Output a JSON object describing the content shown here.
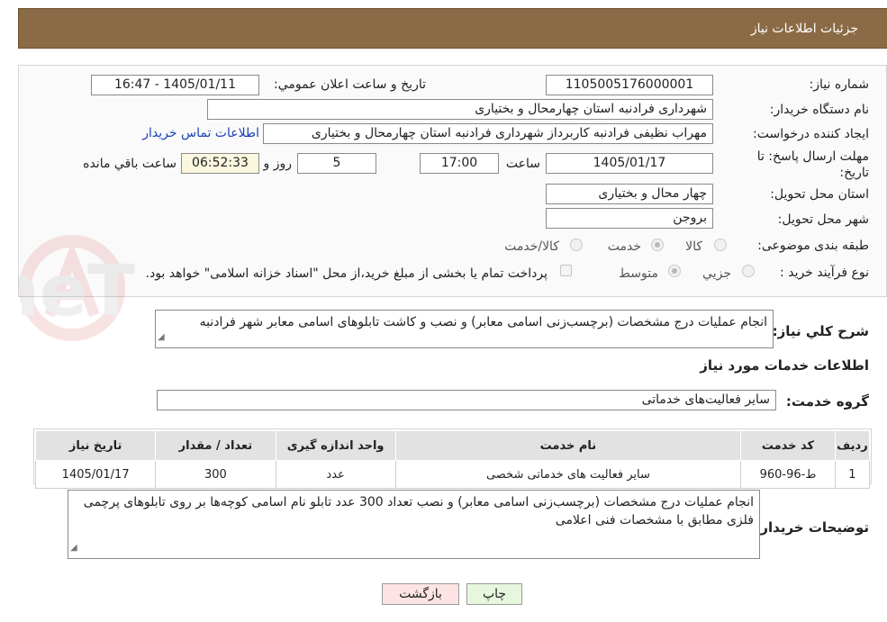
{
  "header": {
    "title": "جزئیات اطلاعات نیاز"
  },
  "form": {
    "need_number_label": "شماره نیاز:",
    "need_number": "1105005176000001",
    "announce_label": "تاریخ و ساعت اعلان عمومي:",
    "announce_value": "1405/01/11 - 16:47",
    "buyer_org_label": "نام دستگاه خريدار:",
    "buyer_org": "شهرداری فرادنبه استان چهارمحال و بختیاری",
    "creator_label": "ايجاد کننده درخواست:",
    "creator": "مهراب نظیفی فرادنبه کاربرداز شهرداری فرادنبه استان چهارمحال و بختیاری",
    "contact_link": "اطلاعات تماس خريدار",
    "deadline_label": "مهلت ارسال پاسخ: تا تاریخ:",
    "deadline_date": "1405/01/17",
    "time_label": "ساعت",
    "deadline_time": "17:00",
    "days_value": "5",
    "days_label": "روز و",
    "remaining_time": "06:52:33",
    "remaining_label": "ساعت باقي مانده",
    "province_label": "استان محل تحویل:",
    "province": "چهار محال و بختیاری",
    "city_label": "شهر محل تحویل:",
    "city": "بروجن",
    "category_label": "طبقه بندی موضوعی:",
    "category_options": [
      "کالا",
      "خدمت",
      "کالا/خدمت"
    ],
    "category_selected": "خدمت",
    "process_label": "نوع فرآیند خرید :",
    "process_options": [
      "جزیي",
      "متوسط"
    ],
    "payment_note": "پرداخت تمام یا بخشی از مبلغ خرید،از محل \"اسناد خزانه اسلامی\" خواهد بود."
  },
  "summary": {
    "label": "شرح کلي نياز:",
    "text": "انجام عملیات درج مشخصات (برچسب‌زنی اسامی معابر) و نصب و کاشت تابلوهای اسامی معابر شهر فرادنبه"
  },
  "services": {
    "section_title": "اطلاعات خدمات مورد نياز",
    "group_label": "گروه خدمت:",
    "group_value": "سایر فعالیت‌های خدماتی",
    "columns": [
      "ردیف",
      "کد خدمت",
      "نام خدمت",
      "واحد اندازه گیری",
      "تعداد / مقدار",
      "تاریخ نیاز"
    ],
    "rows": [
      {
        "row": "1",
        "code": "ط-96-960",
        "name": "سایر فعالیت های خدماتی شخصی",
        "unit": "عدد",
        "qty": "300",
        "date": "1405/01/17"
      }
    ]
  },
  "buyer_notes": {
    "label": "توضیحات خریدار:",
    "text": "انجام عملیات درج مشخصات (برچسب‌زنی اسامی معابر) و نصب تعداد 300 عدد تابلو نام اسامی کوچه‌ها بر روی تابلوهای پرچمی فلزی مطابق با مشخصات فنی اعلامی"
  },
  "buttons": {
    "print": "چاپ",
    "back": "بازگشت"
  },
  "watermark": {
    "text": "AriaTender.neT"
  },
  "colors": {
    "header_bg": "#8b6b45",
    "link": "#1a3fb8",
    "back_btn_bg": "#fde3e3",
    "print_btn_bg": "#e6f7dd"
  }
}
